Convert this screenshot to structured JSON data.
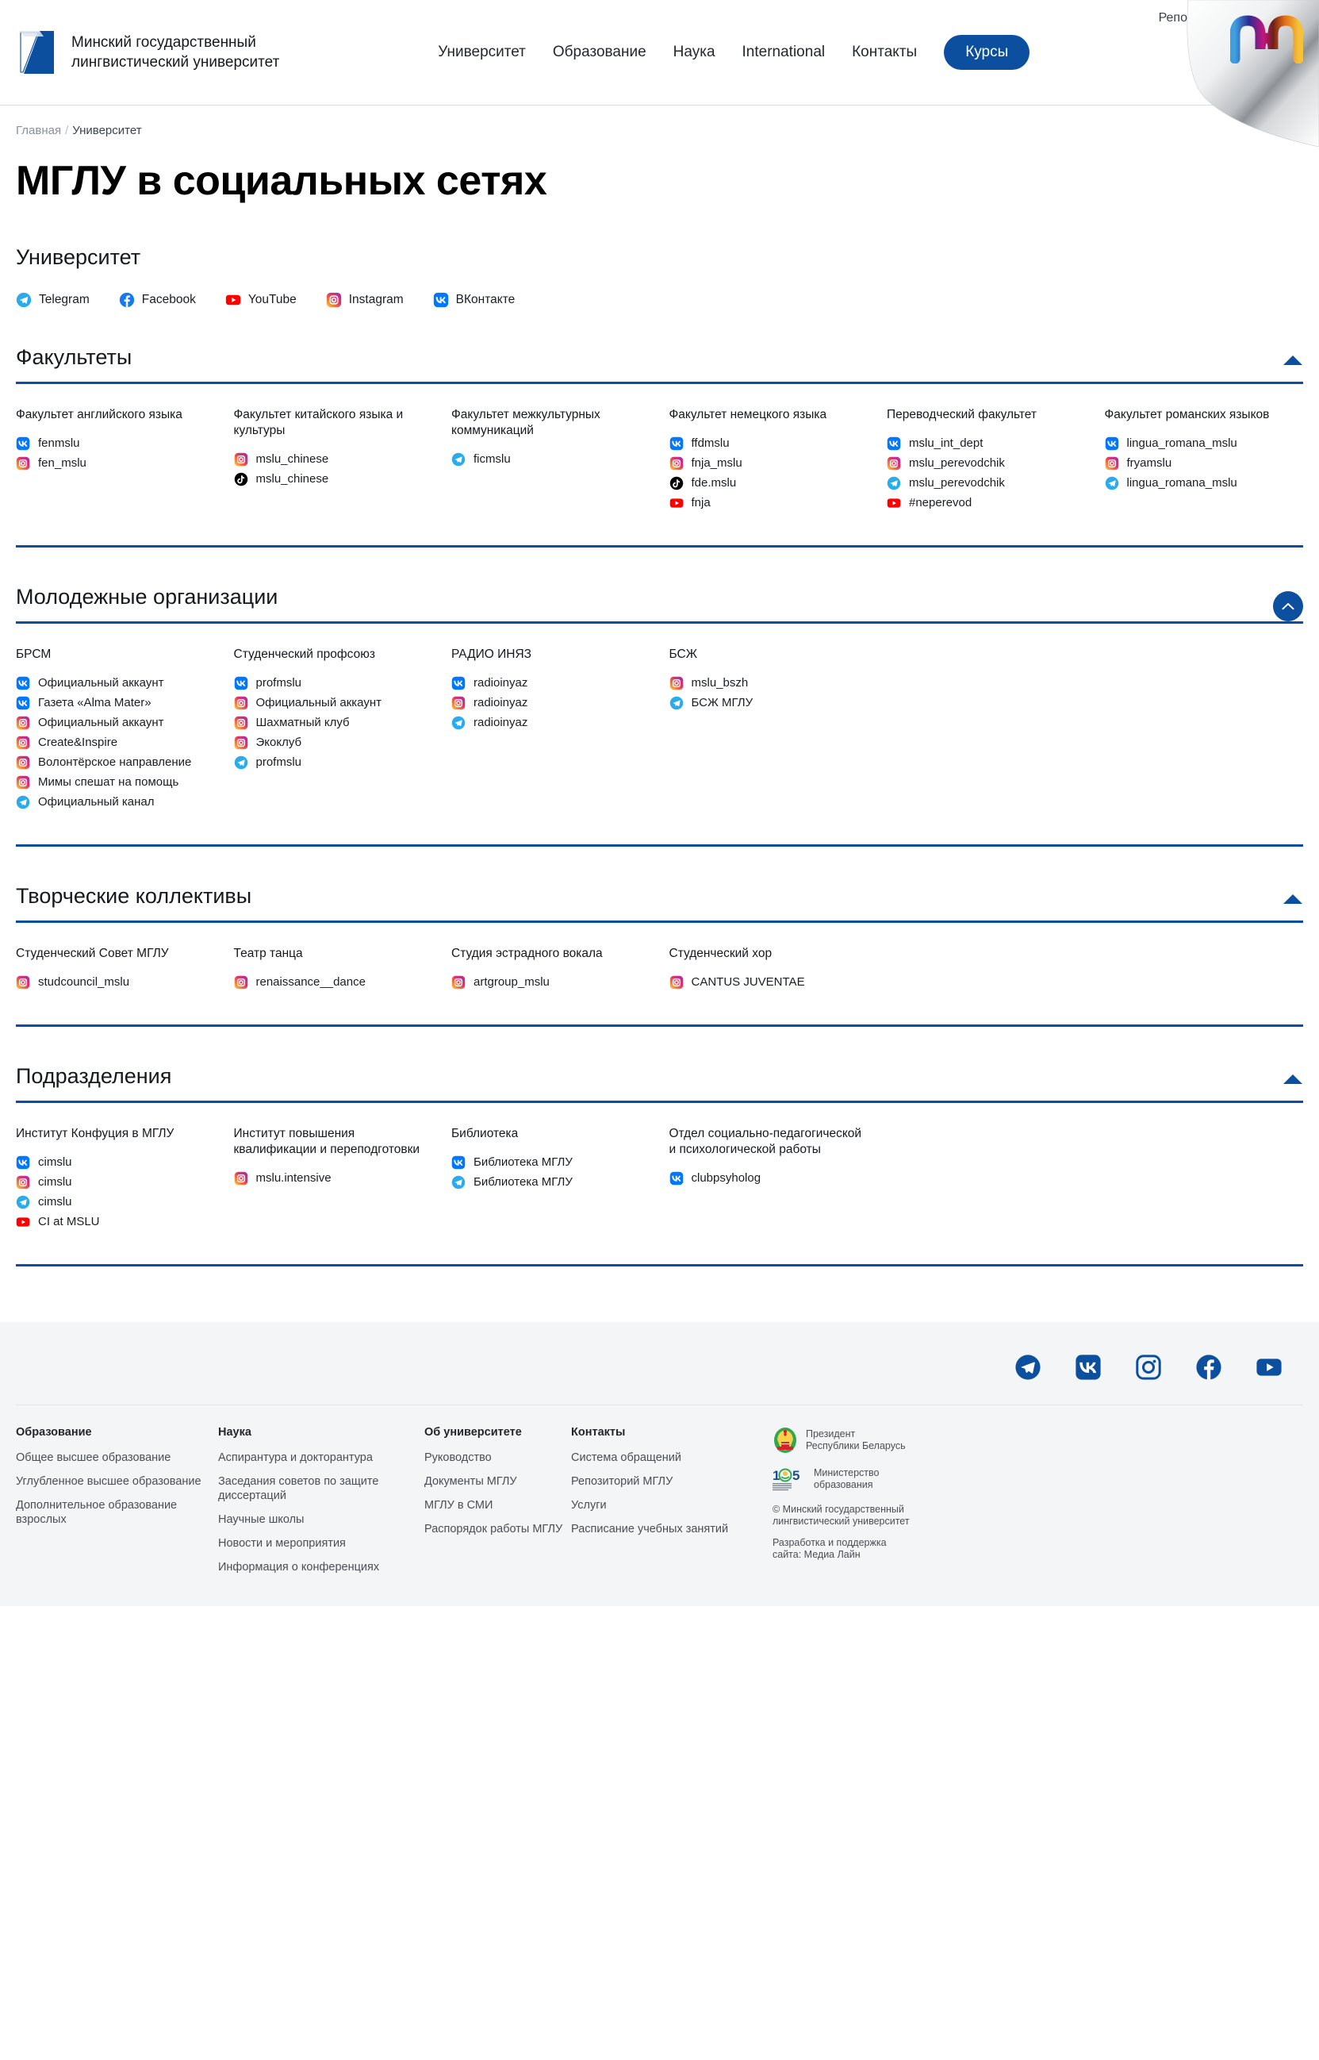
{
  "header": {
    "brand_name": "Минский государственный\nлингвистический университет",
    "nav": [
      {
        "label": "Университет"
      },
      {
        "label": "Образование"
      },
      {
        "label": "Наука"
      },
      {
        "label": "International"
      },
      {
        "label": "Контакты"
      }
    ],
    "cta_label": "Курсы",
    "curl_label": "Репо"
  },
  "breadcrumb": {
    "home": "Главная",
    "separator": "/",
    "current": "Университет"
  },
  "page_title": "МГЛУ в социальных сетях",
  "university": {
    "heading": "Университет",
    "socials": [
      {
        "icon": "telegram-icon",
        "label": "Telegram"
      },
      {
        "icon": "facebook-icon",
        "label": "Facebook"
      },
      {
        "icon": "youtube-icon",
        "label": "YouTube"
      },
      {
        "icon": "instagram-icon",
        "label": "Instagram"
      },
      {
        "icon": "vk-icon",
        "label": "ВКонтакте"
      }
    ]
  },
  "sections": [
    {
      "title": "Факультеты",
      "expanded": true,
      "columns": [
        {
          "title": "Факультет английского языка",
          "accounts": [
            {
              "icon": "vk-icon",
              "label": "fenmslu"
            },
            {
              "icon": "instagram-icon",
              "label": "fen_mslu"
            }
          ]
        },
        {
          "title": "Факультет китайского языка и культуры",
          "accounts": [
            {
              "icon": "instagram-icon",
              "label": "mslu_chinese"
            },
            {
              "icon": "tiktok-icon",
              "label": "mslu_chinese"
            }
          ]
        },
        {
          "title": "Факультет межкультурных коммуникаций",
          "accounts": [
            {
              "icon": "telegram-icon",
              "label": "ficmslu"
            }
          ]
        },
        {
          "title": "Факультет немецкого языка",
          "accounts": [
            {
              "icon": "vk-icon",
              "label": "ffdmslu"
            },
            {
              "icon": "instagram-icon",
              "label": "fnja_mslu"
            },
            {
              "icon": "tiktok-icon",
              "label": "fde.mslu"
            },
            {
              "icon": "youtube-icon",
              "label": "fnja"
            }
          ]
        },
        {
          "title": "Переводческий факультет",
          "accounts": [
            {
              "icon": "vk-icon",
              "label": "mslu_int_dept"
            },
            {
              "icon": "instagram-icon",
              "label": "mslu_perevodchik"
            },
            {
              "icon": "telegram-icon",
              "label": "mslu_perevodchik"
            },
            {
              "icon": "youtube-icon",
              "label": "#neperevod"
            }
          ]
        },
        {
          "title": "Факультет романских языков",
          "accounts": [
            {
              "icon": "vk-icon",
              "label": "lingua_romana_mslu"
            },
            {
              "icon": "instagram-icon",
              "label": "fryamslu"
            },
            {
              "icon": "telegram-icon",
              "label": "lingua_romana_mslu"
            }
          ]
        }
      ]
    },
    {
      "title": "Молодежные организации",
      "expanded": true,
      "columns": [
        {
          "title": "БРСМ",
          "accounts": [
            {
              "icon": "vk-icon",
              "label": "Официальный аккаунт"
            },
            {
              "icon": "vk-icon",
              "label": "Газета «Alma Mater»"
            },
            {
              "icon": "instagram-icon",
              "label": "Официальный аккаунт"
            },
            {
              "icon": "instagram-icon",
              "label": "Create&Inspire"
            },
            {
              "icon": "instagram-icon",
              "label": "Волонтёрское направление"
            },
            {
              "icon": "instagram-icon",
              "label": "Мимы спешат на помощь"
            },
            {
              "icon": "telegram-icon",
              "label": "Официальный канал"
            }
          ]
        },
        {
          "title": "Студенческий профсоюз",
          "accounts": [
            {
              "icon": "vk-icon",
              "label": "profmslu"
            },
            {
              "icon": "instagram-icon",
              "label": "Официальный аккаунт"
            },
            {
              "icon": "instagram-icon",
              "label": "Шахматный клуб"
            },
            {
              "icon": "instagram-icon",
              "label": "Экоклуб"
            },
            {
              "icon": "telegram-icon",
              "label": "profmslu"
            }
          ]
        },
        {
          "title": "РАДИО ИНЯЗ",
          "accounts": [
            {
              "icon": "vk-icon",
              "label": "radioinyaz"
            },
            {
              "icon": "instagram-icon",
              "label": "radioinyaz"
            },
            {
              "icon": "telegram-icon",
              "label": "radioinyaz"
            }
          ]
        },
        {
          "title": "БСЖ",
          "accounts": [
            {
              "icon": "instagram-icon",
              "label": "mslu_bszh"
            },
            {
              "icon": "telegram-icon",
              "label": "БСЖ МГЛУ"
            }
          ]
        },
        {
          "title": "",
          "accounts": []
        },
        {
          "title": "",
          "accounts": []
        }
      ]
    },
    {
      "title": "Творческие коллективы",
      "expanded": true,
      "columns": [
        {
          "title": "Студенческий Совет МГЛУ",
          "accounts": [
            {
              "icon": "instagram-icon",
              "label": "studcouncil_mslu"
            }
          ]
        },
        {
          "title": "Театр танца",
          "accounts": [
            {
              "icon": "instagram-icon",
              "label": "renaissance__dance"
            }
          ]
        },
        {
          "title": "Студия эстрадного вокала",
          "accounts": [
            {
              "icon": "instagram-icon",
              "label": "artgroup_mslu"
            }
          ]
        },
        {
          "title": "Студенческий хор",
          "accounts": [
            {
              "icon": "instagram-icon",
              "label": "CANTUS JUVENTAE"
            }
          ]
        },
        {
          "title": "",
          "accounts": []
        },
        {
          "title": "",
          "accounts": []
        }
      ]
    },
    {
      "title": "Подразделения",
      "expanded": true,
      "columns": [
        {
          "title": "Институт Конфуция в МГЛУ",
          "accounts": [
            {
              "icon": "vk-icon",
              "label": "cimslu"
            },
            {
              "icon": "instagram-icon",
              "label": "cimslu"
            },
            {
              "icon": "telegram-icon",
              "label": "cimslu"
            },
            {
              "icon": "youtube-icon",
              "label": "CI at MSLU"
            }
          ]
        },
        {
          "title": "Институт повышения квалификации и переподготовки",
          "accounts": [
            {
              "icon": "instagram-icon",
              "label": "mslu.intensive"
            }
          ]
        },
        {
          "title": "Библиотека",
          "accounts": [
            {
              "icon": "vk-icon",
              "label": "Библиотека МГЛУ"
            },
            {
              "icon": "telegram-icon",
              "label": "Библиотека МГЛУ"
            }
          ]
        },
        {
          "title": "Отдел социально-педагогической и психологической работы",
          "accounts": [
            {
              "icon": "vk-icon",
              "label": "clubpsyholog"
            }
          ]
        },
        {
          "title": "",
          "accounts": []
        },
        {
          "title": "",
          "accounts": []
        }
      ]
    }
  ],
  "footer": {
    "socials": [
      {
        "icon": "telegram-icon"
      },
      {
        "icon": "vk-icon"
      },
      {
        "icon": "instagram-icon"
      },
      {
        "icon": "facebook-icon"
      },
      {
        "icon": "youtube-icon"
      }
    ],
    "columns": [
      {
        "title": "Образование",
        "links": [
          "Общее высшее образование",
          "Углубленное высшее образование",
          "Дополнительное образование взрослых"
        ]
      },
      {
        "title": "Наука",
        "links": [
          "Аспирантура и докторантура",
          "Заседания советов по защите диссертаций",
          "Научные школы",
          "Новости и мероприятия",
          "Информация о конференциях"
        ]
      },
      {
        "title": "Об университете",
        "links": [
          "Руководство",
          "Документы МГЛУ",
          "МГЛУ в СМИ",
          "Распорядок работы МГЛУ"
        ]
      },
      {
        "title": "Контакты",
        "links": [
          "Система обращений",
          "Репозиторий МГЛУ",
          "Услуги",
          "Расписание учебных занятий"
        ]
      }
    ],
    "gov": [
      {
        "icon": "belarus-coat-of-arms-icon",
        "text": "Президент\nРеспублики Беларусь"
      },
      {
        "icon": "ministry-105-icon",
        "text": "Министерство\nобразования"
      }
    ],
    "copyright": "© Минский государственный\nлингвистический университет",
    "developer": "Разработка и поддержка\nсайта: Медиа Лайн"
  },
  "colors": {
    "brand_blue": "#0b4f9e",
    "vk": "#0077ff",
    "telegram": "#2aabee",
    "youtube": "#ff0000",
    "instagram_start": "#feda75",
    "instagram_end": "#962fbf",
    "facebook": "#1877f2",
    "tiktok": "#000000",
    "footer_bg": "#f4f5f6"
  }
}
